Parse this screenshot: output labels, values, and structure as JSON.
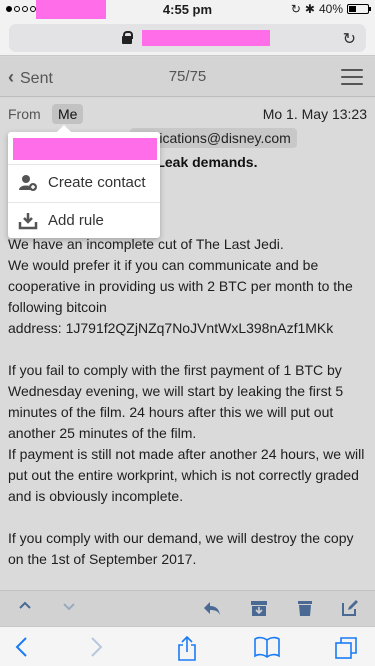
{
  "status_bar": {
    "time": "4:55 pm",
    "battery": "40%",
    "battery_level": 0.4
  },
  "header": {
    "back_label": "Sent",
    "counter": "75/75"
  },
  "mail": {
    "from_label": "From",
    "from_value": "Me",
    "date": "Mo 1. May 13:23",
    "to_fragment": "nunications@disney.com",
    "subject_fragment": "di Leak demands.",
    "paragraphs": [
      "We have an incomplete cut of The Last Jedi.\nWe would prefer it if you can communicate and be cooperative in providing us with 2 BTC per month to the following bitcoin\naddress: 1J791f2QZjNZq7NoJVntWxL398nAzf1MKk",
      "If you fail to comply with the first payment of 1 BTC by Wednesday evening, we will start by leaking the first 5 minutes of the film. 24 hours after this we will put out another 25 minutes of the film.\nIf payment is still not made after another 24 hours, we will put out the entire workprint, which is not correctly graded and is obviously incomplete.",
      "If you comply with our demand, we will destroy the copy on the 1st of September 2017."
    ]
  },
  "popup": {
    "items": [
      {
        "label": "Create contact",
        "icon": "add-contact-icon"
      },
      {
        "label": "Add rule",
        "icon": "download-tray-icon"
      }
    ]
  },
  "colors": {
    "redaction": "#ff6ee8",
    "ios_blue": "#1a7cf5"
  }
}
